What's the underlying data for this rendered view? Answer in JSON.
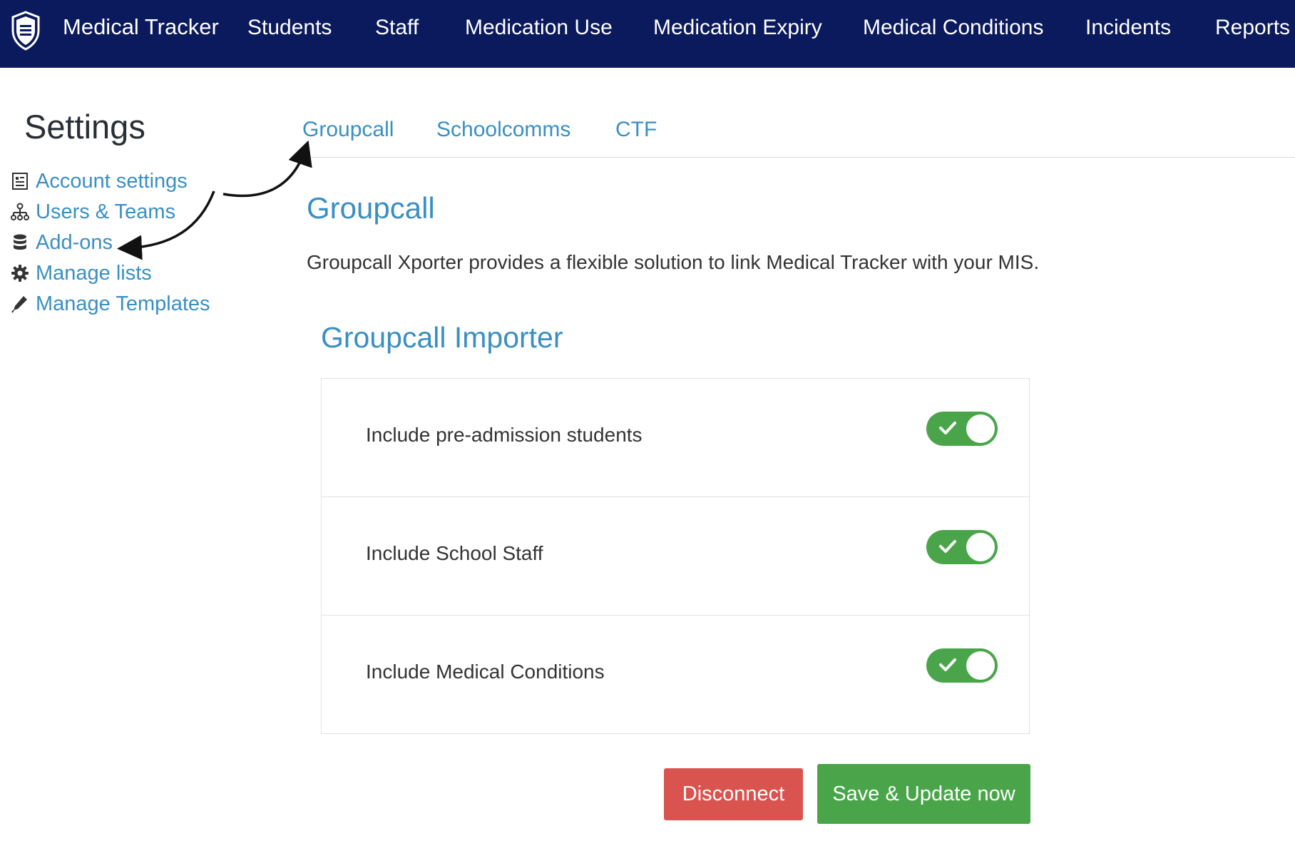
{
  "navbar": {
    "brand": "Medical Tracker",
    "items": [
      {
        "label": "Students"
      },
      {
        "label": "Staff"
      },
      {
        "label": "Medication Use"
      },
      {
        "label": "Medication Expiry"
      },
      {
        "label": "Medical Conditions"
      },
      {
        "label": "Incidents"
      },
      {
        "label": "Reports"
      }
    ]
  },
  "sidebar": {
    "title": "Settings",
    "items": [
      {
        "label": "Account settings",
        "icon": "list-document-icon"
      },
      {
        "label": "Users & Teams",
        "icon": "org-chart-icon"
      },
      {
        "label": "Add-ons",
        "icon": "database-icon"
      },
      {
        "label": "Manage lists",
        "icon": "gear-icon"
      },
      {
        "label": "Manage Templates",
        "icon": "pencil-icon"
      }
    ]
  },
  "tabs": [
    {
      "label": "Groupcall"
    },
    {
      "label": "Schoolcomms"
    },
    {
      "label": "CTF"
    }
  ],
  "main": {
    "title": "Groupcall",
    "description": "Groupcall Xporter provides a flexible solution to link Medical Tracker with your MIS.",
    "importer_title": "Groupcall Importer",
    "options": [
      {
        "label": "Include pre-admission students",
        "enabled": true
      },
      {
        "label": "Include School Staff",
        "enabled": true
      },
      {
        "label": "Include Medical Conditions",
        "enabled": true
      }
    ]
  },
  "buttons": {
    "disconnect": "Disconnect",
    "save": "Save & Update now"
  },
  "colors": {
    "navbar_bg": "#0b1a5c",
    "link": "#3a8fc2",
    "toggle_on": "#4aa54a",
    "danger": "#d9534f",
    "success": "#4aa54a"
  }
}
